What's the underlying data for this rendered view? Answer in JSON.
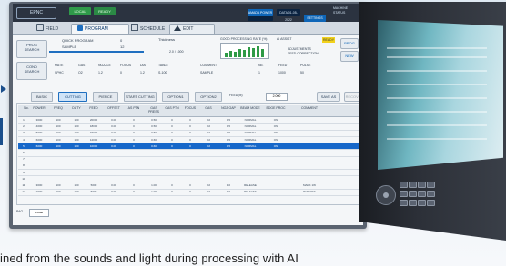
{
  "topbar": {
    "logo": "EPNC",
    "status_1": "LOCAL",
    "status_2": "READY",
    "btn_1": "AMADA POWER",
    "btn_2": "DATA 01-05-2022",
    "btn_3": "SETTINGS",
    "info": "MACHINE STATUS"
  },
  "tabs": [
    {
      "label": "FIELD"
    },
    {
      "label": "PROGRAM"
    },
    {
      "label": "SCHEDULE"
    },
    {
      "label": "EDIT"
    }
  ],
  "left_buttons": {
    "prog": "PROG\nSEARCH",
    "cond": "COND\nSEARCH"
  },
  "program": {
    "name": "QUICK PROGRAM",
    "material": "SAMPLE",
    "num1": "0",
    "num2": "12"
  },
  "thickness": {
    "label": "Thickness",
    "value": "2.0 / 1000"
  },
  "graph": {
    "label": "GOOD PROCESSING RATE (%)"
  },
  "right_panel": {
    "label": "AI ASSIST",
    "ready": "READY",
    "line1": "ADJUSTMENTS",
    "line2": "FEED CORRECTION",
    "btn_1": "PROG",
    "btn_2": "NEW"
  },
  "header2": {
    "labels": [
      "MATE",
      "GAS",
      "NOZZLE",
      "FOCUS",
      "DIA",
      "TABLE",
      "COMMENT",
      "No.",
      "FEED",
      "PULSE"
    ],
    "values": [
      "SPHC",
      "O2",
      "1.2",
      "0",
      "1.2",
      "S-100",
      "SAMPLE",
      "1",
      "1000",
      "50"
    ]
  },
  "subtabs": [
    {
      "label": "BASIC",
      "active": false
    },
    {
      "label": "CUTTING",
      "active": true
    },
    {
      "label": "PIERCE",
      "active": false
    },
    {
      "label": "START CUTTING",
      "active": false
    },
    {
      "label": "OPTION1",
      "active": false
    },
    {
      "label": "OPTION2",
      "active": false
    }
  ],
  "feed_rate": {
    "label": "FEED(M)",
    "value": "2.000"
  },
  "save_as": "SAVE AS",
  "recover": "RECOVER",
  "table": {
    "headers": [
      "No.",
      "POWER",
      "FREQ",
      "DUTY",
      "FEED",
      "OFFSET",
      "AS PTN",
      "GAS PRESS",
      "GAS PTN",
      "FOCUS",
      "GAS",
      "NOZ GAP",
      "BEAM MODE",
      "EDGE PROC",
      "COMMENT"
    ],
    "rows": [
      [
        "1",
        "3000",
        "100",
        "100",
        "20000",
        "0.00",
        "0",
        "0.50",
        "0",
        "0",
        "O2",
        "0.5",
        "NORMAL",
        "ON",
        ""
      ],
      [
        "2",
        "4000",
        "100",
        "100",
        "18000",
        "0.00",
        "0",
        "0.50",
        "0",
        "0",
        "O2",
        "0.5",
        "NORMAL",
        "ON",
        ""
      ],
      [
        "3",
        "5000",
        "100",
        "100",
        "15000",
        "0.00",
        "0",
        "0.50",
        "0",
        "0",
        "O2",
        "0.5",
        "NORMAL",
        "ON",
        ""
      ],
      [
        "4",
        "6000",
        "100",
        "100",
        "12000",
        "0.00",
        "0",
        "0.60",
        "0",
        "0",
        "O2",
        "0.5",
        "NORMAL",
        "ON",
        ""
      ],
      [
        "5",
        "6000",
        "100",
        "100",
        "10000",
        "0.00",
        "0",
        "0.60",
        "0",
        "0",
        "O2",
        "0.5",
        "NORMAL",
        "ON",
        ""
      ],
      [
        "6",
        "",
        "",
        "",
        "",
        "",
        "",
        "",
        "",
        "",
        "",
        "",
        "",
        "",
        ""
      ],
      [
        "7",
        "",
        "",
        "",
        "",
        "",
        "",
        "",
        "",
        "",
        "",
        "",
        "",
        "",
        ""
      ],
      [
        "8",
        "",
        "",
        "",
        "",
        "",
        "",
        "",
        "",
        "",
        "",
        "",
        "",
        "",
        ""
      ],
      [
        "9",
        "",
        "",
        "",
        "",
        "",
        "",
        "",
        "",
        "",
        "",
        "",
        "",
        "",
        ""
      ],
      [
        "10",
        "",
        "",
        "",
        "",
        "",
        "",
        "",
        "",
        "",
        "",
        "",
        "",
        "",
        ""
      ],
      [
        "11",
        "3000",
        "100",
        "100",
        "5000",
        "0.00",
        "0",
        "1.00",
        "0",
        "0",
        "O2",
        "1.0",
        "RELEASE",
        "",
        "MARK 1W"
      ],
      [
        "12",
        "2000",
        "100",
        "100",
        "5000",
        "0.00",
        "0",
        "1.00",
        "0",
        "0",
        "O2",
        "1.0",
        "RELEASE",
        "",
        "PARTOFF"
      ]
    ]
  },
  "page": {
    "label": "PAG",
    "value": "PAGE"
  },
  "caption": "ined from the sounds and light during processing with AI"
}
